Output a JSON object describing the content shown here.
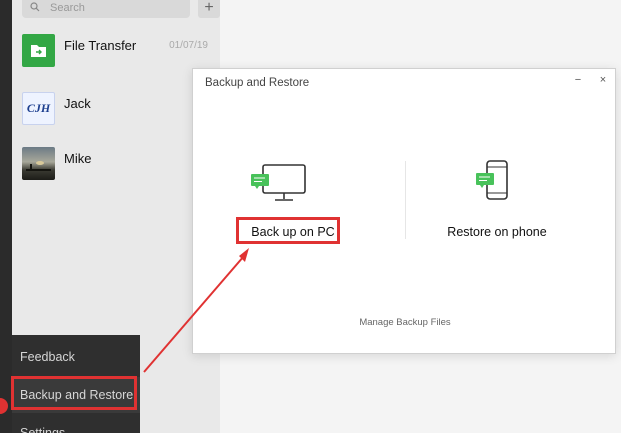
{
  "search": {
    "placeholder": "Search"
  },
  "add_label": "+",
  "chats": [
    {
      "name": "File Transfer",
      "date": "01/07/19",
      "avatar": "file-transfer-icon",
      "avatar_text": ""
    },
    {
      "name": "Jack",
      "date": "",
      "avatar": "cjh-logo",
      "avatar_text": "CJH"
    },
    {
      "name": "Mike",
      "date": "",
      "avatar": "sunset-photo",
      "avatar_text": ""
    }
  ],
  "menu": {
    "items": [
      {
        "label": "Feedback"
      },
      {
        "label": "Backup and Restore"
      },
      {
        "label": "Settings"
      }
    ]
  },
  "dialog": {
    "title": "Backup and Restore",
    "minimize_label": "−",
    "close_label": "×",
    "backup_label": "Back up on PC",
    "restore_label": "Restore on phone",
    "manage_label": "Manage Backup Files"
  },
  "colors": {
    "highlight": "#e03232",
    "chat_bubble": "#48c25a",
    "sidebar": "#2b2b2b"
  }
}
